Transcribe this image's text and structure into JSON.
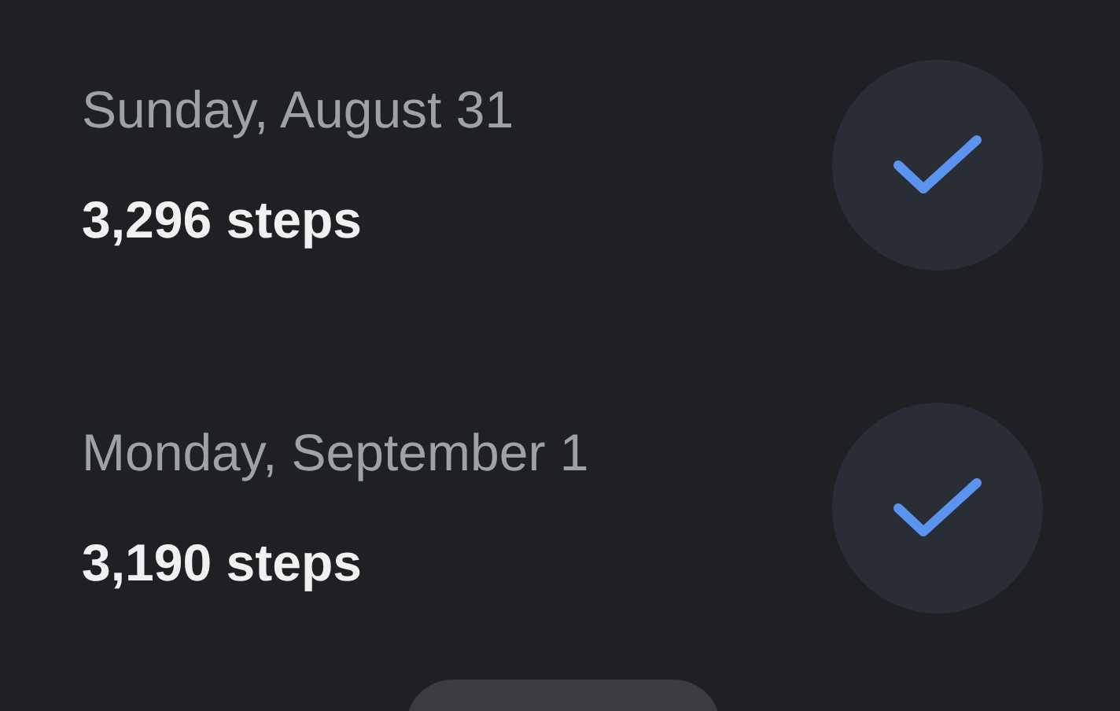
{
  "days": [
    {
      "date": "Sunday, August 31",
      "steps": "3,296 steps",
      "checked": true
    },
    {
      "date": "Monday, September 1",
      "steps": "3,190 steps",
      "checked": true
    }
  ],
  "bottom_button": {
    "visible": true
  }
}
